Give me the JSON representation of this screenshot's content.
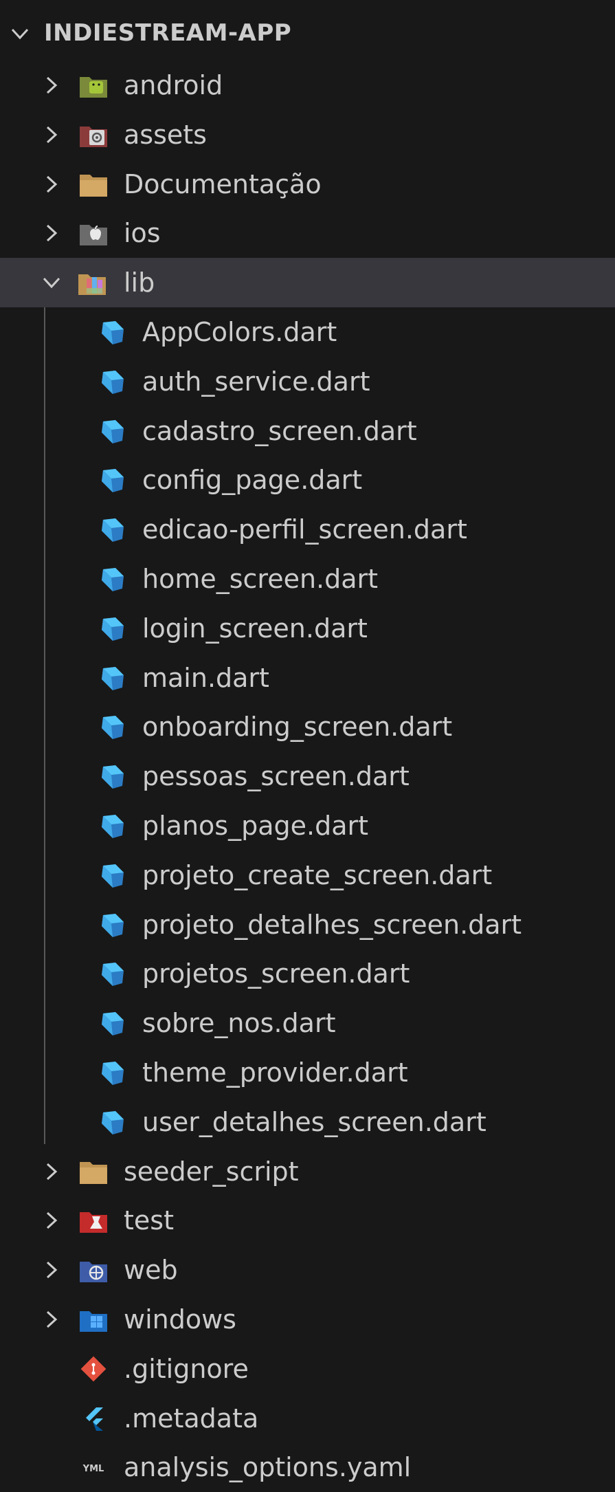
{
  "explorer": {
    "project_title": "INDIESTREAM-APP",
    "colors": {
      "background": "#181818",
      "selected_row": "#37373d",
      "text": "#cccccc",
      "dart_blue": "#54c5f8",
      "folder": "#c09553"
    },
    "top_folders": [
      {
        "label": "android",
        "icon": "android-folder-icon"
      },
      {
        "label": "assets",
        "icon": "assets-folder-icon"
      },
      {
        "label": "Documentação",
        "icon": "folder-icon"
      },
      {
        "label": "ios",
        "icon": "ios-folder-icon"
      }
    ],
    "lib_folder": {
      "label": "lib",
      "icon": "lib-folder-icon",
      "expanded": true
    },
    "lib_files": [
      {
        "label": "AppColors.dart",
        "icon": "dart-icon"
      },
      {
        "label": "auth_service.dart",
        "icon": "dart-icon"
      },
      {
        "label": "cadastro_screen.dart",
        "icon": "dart-icon"
      },
      {
        "label": "config_page.dart",
        "icon": "dart-icon"
      },
      {
        "label": "edicao-perfil_screen.dart",
        "icon": "dart-icon"
      },
      {
        "label": "home_screen.dart",
        "icon": "dart-icon"
      },
      {
        "label": "login_screen.dart",
        "icon": "dart-icon"
      },
      {
        "label": "main.dart",
        "icon": "dart-icon"
      },
      {
        "label": "onboarding_screen.dart",
        "icon": "dart-icon"
      },
      {
        "label": "pessoas_screen.dart",
        "icon": "dart-icon"
      },
      {
        "label": "planos_page.dart",
        "icon": "dart-icon"
      },
      {
        "label": "projeto_create_screen.dart",
        "icon": "dart-icon"
      },
      {
        "label": "projeto_detalhes_screen.dart",
        "icon": "dart-icon"
      },
      {
        "label": "projetos_screen.dart",
        "icon": "dart-icon"
      },
      {
        "label": "sobre_nos.dart",
        "icon": "dart-icon"
      },
      {
        "label": "theme_provider.dart",
        "icon": "dart-icon"
      },
      {
        "label": "user_detalhes_screen.dart",
        "icon": "dart-icon"
      }
    ],
    "bottom_folders": [
      {
        "label": "seeder_script",
        "icon": "folder-icon"
      },
      {
        "label": "test",
        "icon": "test-folder-icon"
      },
      {
        "label": "web",
        "icon": "web-folder-icon"
      },
      {
        "label": "windows",
        "icon": "windows-folder-icon"
      }
    ],
    "root_files": [
      {
        "label": ".gitignore",
        "icon": "git-icon"
      },
      {
        "label": ".metadata",
        "icon": "flutter-icon"
      },
      {
        "label": "analysis_options.yaml",
        "icon": "yaml-icon"
      }
    ]
  }
}
